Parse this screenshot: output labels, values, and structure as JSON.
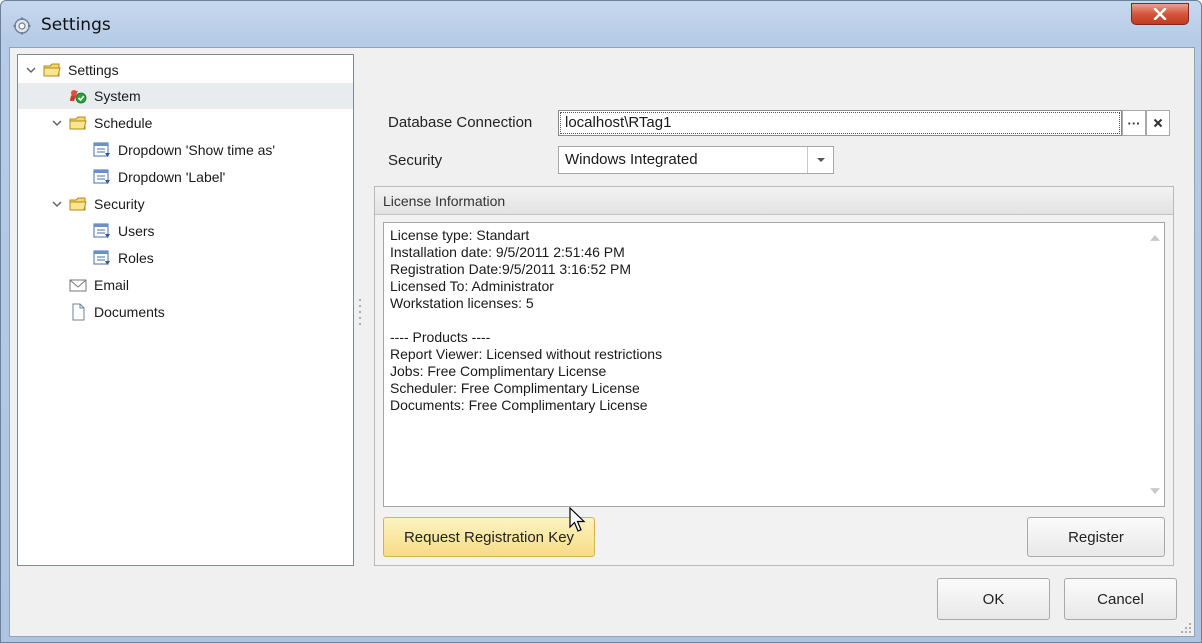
{
  "window": {
    "title": "Settings"
  },
  "tree": {
    "items": [
      {
        "label": "Settings",
        "icon": "folder-icon",
        "level": 0,
        "expanded": true
      },
      {
        "label": "System",
        "icon": "system-check-icon",
        "level": 1,
        "selected": true
      },
      {
        "label": "Schedule",
        "icon": "folder-icon",
        "level": 1,
        "expanded": true
      },
      {
        "label": "Dropdown 'Show time as'",
        "icon": "list-icon",
        "level": 2
      },
      {
        "label": "Dropdown 'Label'",
        "icon": "list-icon",
        "level": 2
      },
      {
        "label": "Security",
        "icon": "folder-icon",
        "level": 1,
        "expanded": true
      },
      {
        "label": "Users",
        "icon": "list-icon",
        "level": 2
      },
      {
        "label": "Roles",
        "icon": "list-icon",
        "level": 2
      },
      {
        "label": "Email",
        "icon": "envelope-icon",
        "level": 1
      },
      {
        "label": "Documents",
        "icon": "document-icon",
        "level": 1
      }
    ]
  },
  "form": {
    "db_label": "Database Connection",
    "db_value": "localhost\\RTag1",
    "db_browse": "···",
    "db_clear": "✕",
    "security_label": "Security",
    "security_value": "Windows Integrated"
  },
  "license": {
    "header": "License Information",
    "lines": [
      "License type: Standart",
      "Installation date: 9/5/2011 2:51:46 PM",
      "Registration Date:9/5/2011 3:16:52 PM",
      "Licensed To: Administrator",
      "Workstation licenses: 5",
      "",
      "---- Products ----",
      "Report Viewer: Licensed without restrictions",
      "Jobs: Free Complimentary License",
      "Scheduler: Free Complimentary License",
      "Documents: Free Complimentary License"
    ],
    "request_button": "Request Registration Key",
    "register_button": "Register"
  },
  "footer": {
    "ok": "OK",
    "cancel": "Cancel"
  },
  "colors": {
    "title_bar": "#b6cbe6",
    "close_button": "#d4553b",
    "hover_button": "#f6dc84",
    "selected_row": "#e9ecef"
  }
}
